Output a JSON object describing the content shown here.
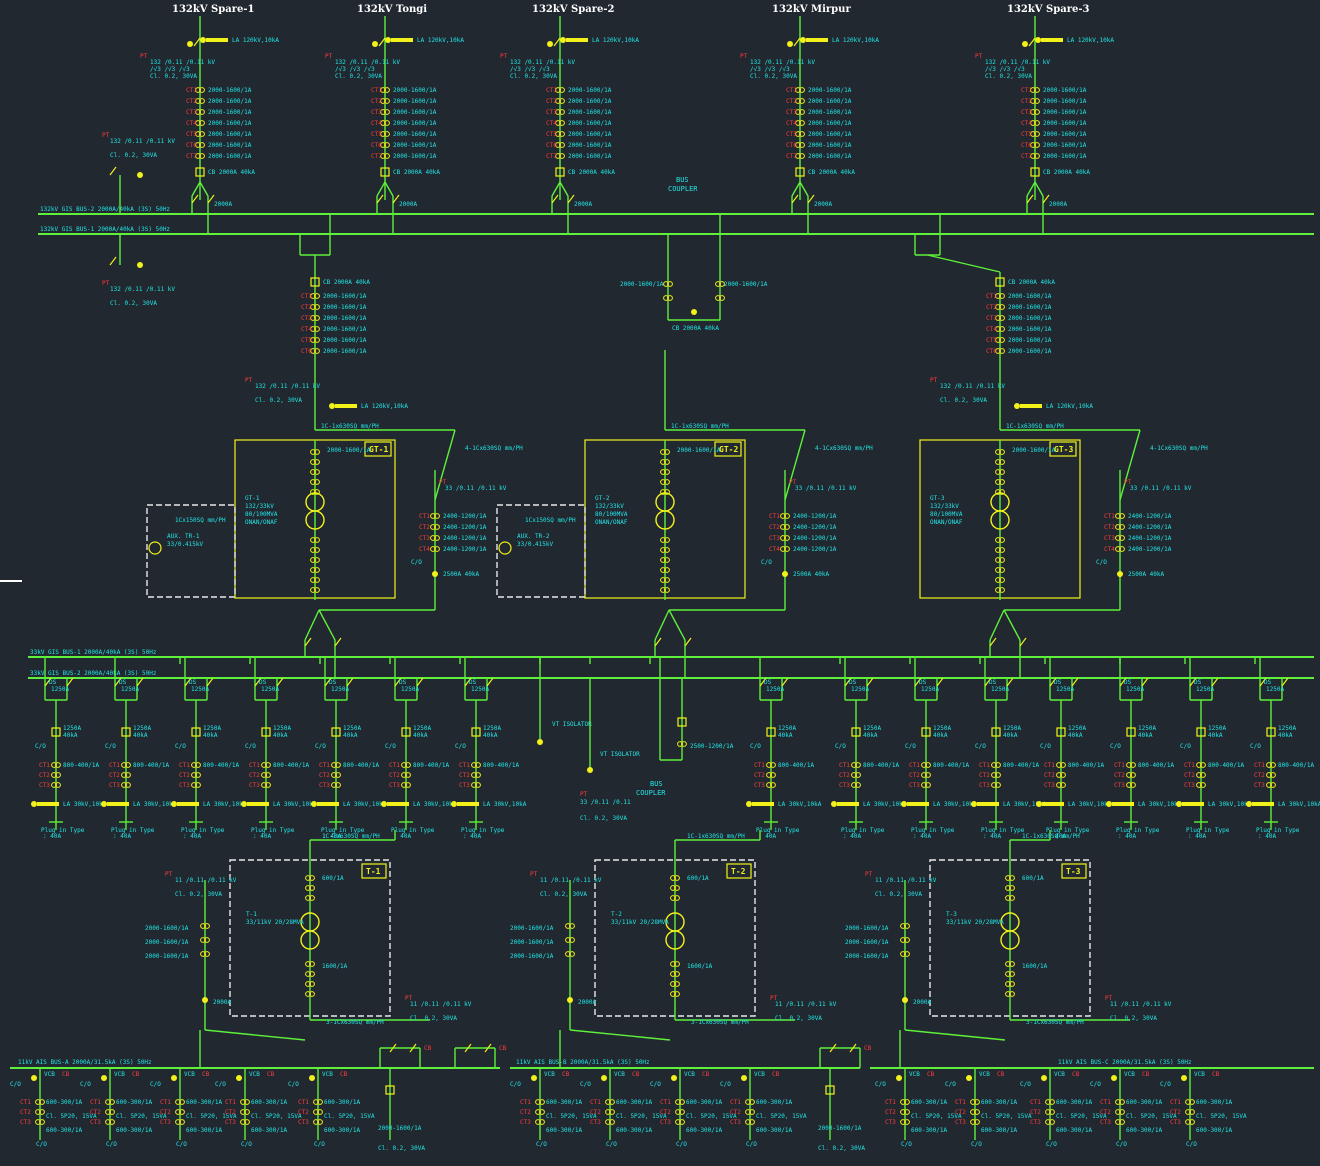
{
  "colors": {
    "background": "#212830",
    "bus": "#5ef03a",
    "equipment": "#f2f21a",
    "text": "#22e6e6",
    "alarm": "#ff3b3b",
    "title": "#ffffff"
  },
  "feeders_132kv": [
    {
      "title": "132kV Spare-1",
      "la": "LA 120kV,10kA"
    },
    {
      "title": "132kV Tongi",
      "la": "LA 120kV,10kA"
    },
    {
      "title": "132kV Spare-2",
      "la": "LA 120kV,10kA"
    },
    {
      "title": "132kV Mirpur",
      "la": "LA 120kV,10kA"
    },
    {
      "title": "132kV Spare-3",
      "la": "LA 120kV,10kA"
    }
  ],
  "bus_132kv": {
    "bus2": "132kV GIS BUS-2 2000A/40kA (3S) 50Hz",
    "bus1": "132kV GIS BUS-1 2000A/40kA (3S) 50Hz",
    "coupler_label": "BUS COUPLER"
  },
  "bus_33kv": {
    "bus1": "33kV GIS BUS-1 2000A/40kA (3S) 50Hz",
    "bus2": "33kV GIS BUS-2 2000A/40kA (3S) 50Hz",
    "coupler_label": "BUS COUPLER"
  },
  "bus_11kv": {
    "a": "11kV AIS BUS-A 2000A/31.5kA (3S) 50Hz",
    "b": "11kV AIS BUS-B 2000A/31.5kA (3S) 50Hz",
    "c": "11kV AIS BUS-C 2000A/31.5kA (3S) 50Hz"
  },
  "grid_transformers": [
    {
      "tag": "GT-1",
      "aux": "AUX. TR-1"
    },
    {
      "tag": "GT-2",
      "aux": "AUX. TR-2"
    },
    {
      "tag": "GT-3",
      "aux": ""
    }
  ],
  "power_transformers": [
    {
      "tag": "T-1"
    },
    {
      "tag": "T-2"
    },
    {
      "tag": "T-3"
    }
  ],
  "labels": {
    "cb_rating": "CB 2000A 40kA",
    "ct_rating": "2000-1600/1A",
    "pt_label": "PT",
    "vt_isolator": "VT ISOLATOR",
    "plug_in": "Plug in Type : 40A",
    "conductor": "1C-1x630SQ mm/PH",
    "gt_spec": "132/33kV 80/100MVA ONAN/ONAF",
    "t_spec": "33/11kV 20/28MVA",
    "la_33": "LA 30kV,10kA",
    "cbo": "C/O"
  }
}
